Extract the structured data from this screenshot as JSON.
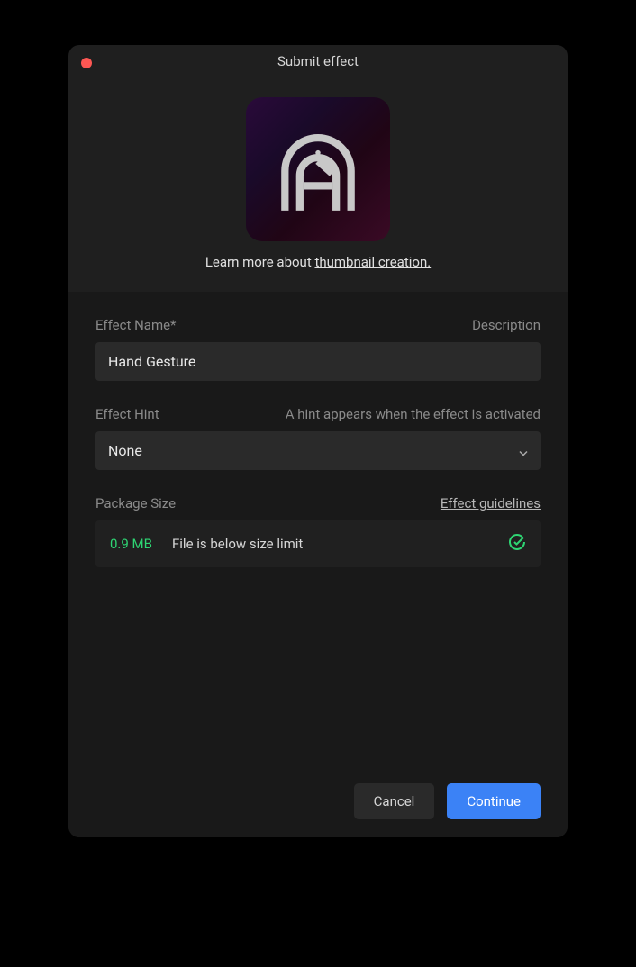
{
  "window": {
    "title": "Submit effect"
  },
  "thumbnail": {
    "learn_more_prefix": "Learn more about ",
    "learn_more_link": "thumbnail creation."
  },
  "effect_name": {
    "label": "Effect Name*",
    "hint": "Description",
    "value": "Hand Gesture"
  },
  "effect_hint": {
    "label": "Effect Hint",
    "hint": "A hint appears when the effect is activated",
    "selected": "None"
  },
  "package": {
    "label": "Package Size",
    "guidelines_link": "Effect guidelines",
    "size": "0.9 MB",
    "message": "File is below size limit"
  },
  "buttons": {
    "cancel": "Cancel",
    "continue": "Continue"
  }
}
